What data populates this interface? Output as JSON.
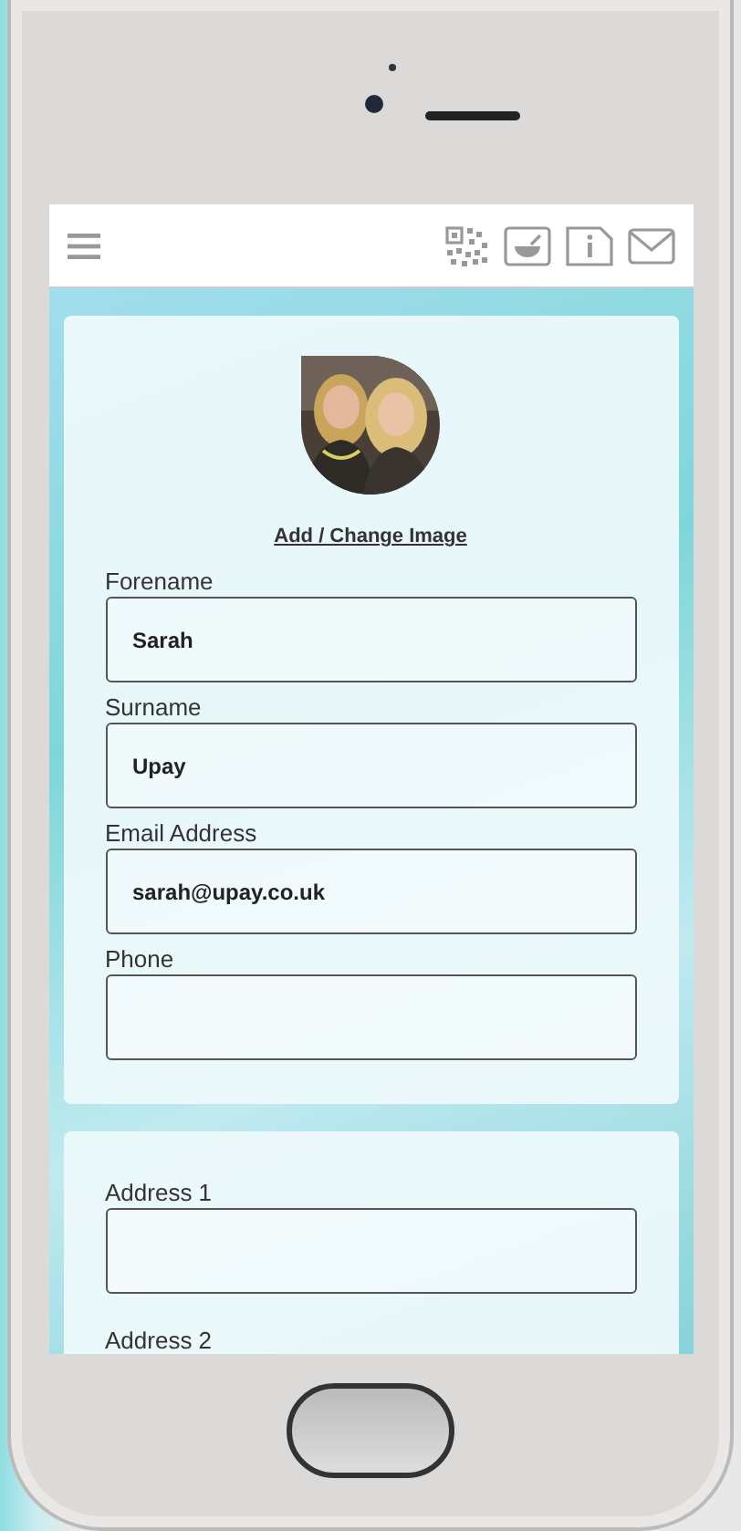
{
  "profile_card": {
    "image_link": "Add / Change Image",
    "fields": [
      {
        "kind": "field",
        "label": "Forename",
        "value": "Sarah"
      },
      {
        "kind": "field",
        "label": "Surname",
        "value": "Upay"
      },
      {
        "kind": "field",
        "label": "Email Address",
        "value": "sarah@upay.co.uk"
      },
      {
        "kind": "field",
        "label": "Phone"
      }
    ]
  },
  "address_card": {
    "fields": [
      {
        "kind": "field",
        "label": "Address 1"
      },
      {
        "kind": "label",
        "label": "Address 2"
      }
    ]
  }
}
